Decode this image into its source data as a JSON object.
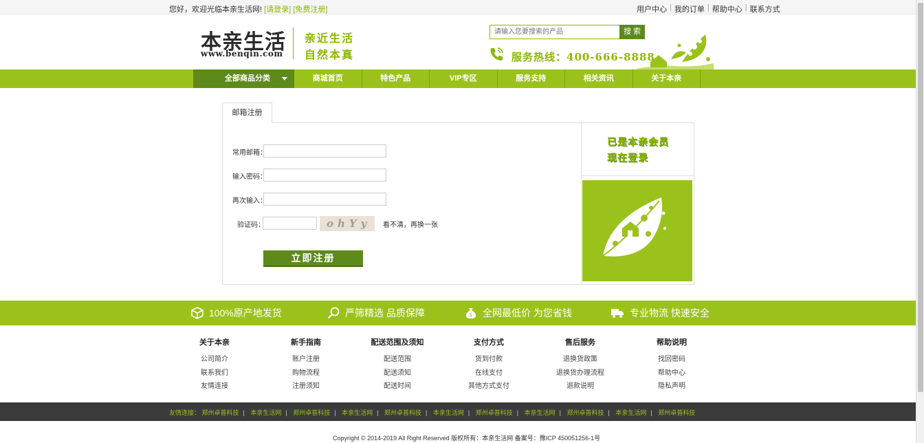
{
  "topbar": {
    "welcome": "您好，欢迎光临本亲生活网!",
    "login_link": "[请登录]",
    "register_link": "[免费注册]",
    "links": [
      "用户中心",
      "我的订单",
      "帮助中心",
      "联系方式"
    ]
  },
  "header": {
    "logo_text": "本亲生活",
    "logo_url": "www.benqin.com",
    "slogan_line1": "亲近生活",
    "slogan_line2": "自然本真",
    "search_placeholder": "请输入您要搜索的产品",
    "search_button": "搜 索",
    "hotline": "服务热线：400-666-8888"
  },
  "nav": {
    "all_categories": "全部商品分类",
    "items": [
      "商城首页",
      "特色产品",
      "VIP专区",
      "服务支持",
      "相关资讯",
      "关于本亲"
    ]
  },
  "register": {
    "tab_label": "邮箱注册",
    "email_label": "常用邮箱：",
    "password_label": "输入密码：",
    "confirm_label": "再次输入：",
    "captcha_label": "验证码：",
    "captcha_text": "ohYy",
    "refresh_link": "看不清，再换一张",
    "submit": "立即注册",
    "member_line1": "已是本亲会员",
    "member_line2": "现在登录"
  },
  "promises": [
    "100%原产地发货",
    "严筛精选  品质保障",
    "全网最低价 为您省钱",
    "专业物流  快速安全"
  ],
  "help": [
    {
      "title": "关于本亲",
      "links": [
        "公司简介",
        "联系我们",
        "友情连接"
      ]
    },
    {
      "title": "新手指南",
      "links": [
        "账户注册",
        "购物流程",
        "注册须知"
      ]
    },
    {
      "title": "配送范围及须知",
      "links": [
        "配送范围",
        "配送须知",
        "配送时间"
      ]
    },
    {
      "title": "支付方式",
      "links": [
        "货到付款",
        "在线支付",
        "其他方式支付"
      ]
    },
    {
      "title": "售后服务",
      "links": [
        "退换货政策",
        "退换货办理流程",
        "退款说明"
      ]
    },
    {
      "title": "帮助说明",
      "links": [
        "找回密码",
        "帮助中心",
        "隐私声明"
      ]
    }
  ],
  "friends": {
    "label": "友情连接：",
    "links": [
      "郑州卓普科技",
      "本亲生活网",
      "郑州卓普科技",
      "本亲生活网",
      "郑州卓普科技",
      "本亲生活网",
      "郑州卓普科技",
      "本亲生活网",
      "郑州卓普科技",
      "本亲生活网",
      "郑州卓普科技"
    ]
  },
  "copyright": "Copyright © 2014-2019 All Right Reserved 版权所有：本亲生活网 备案号：豫ICP 450051256-1号",
  "colors": {
    "brand_green": "#9bc21b",
    "dark_green": "#5e8a1c",
    "footer_dark": "#3b3b3b"
  }
}
